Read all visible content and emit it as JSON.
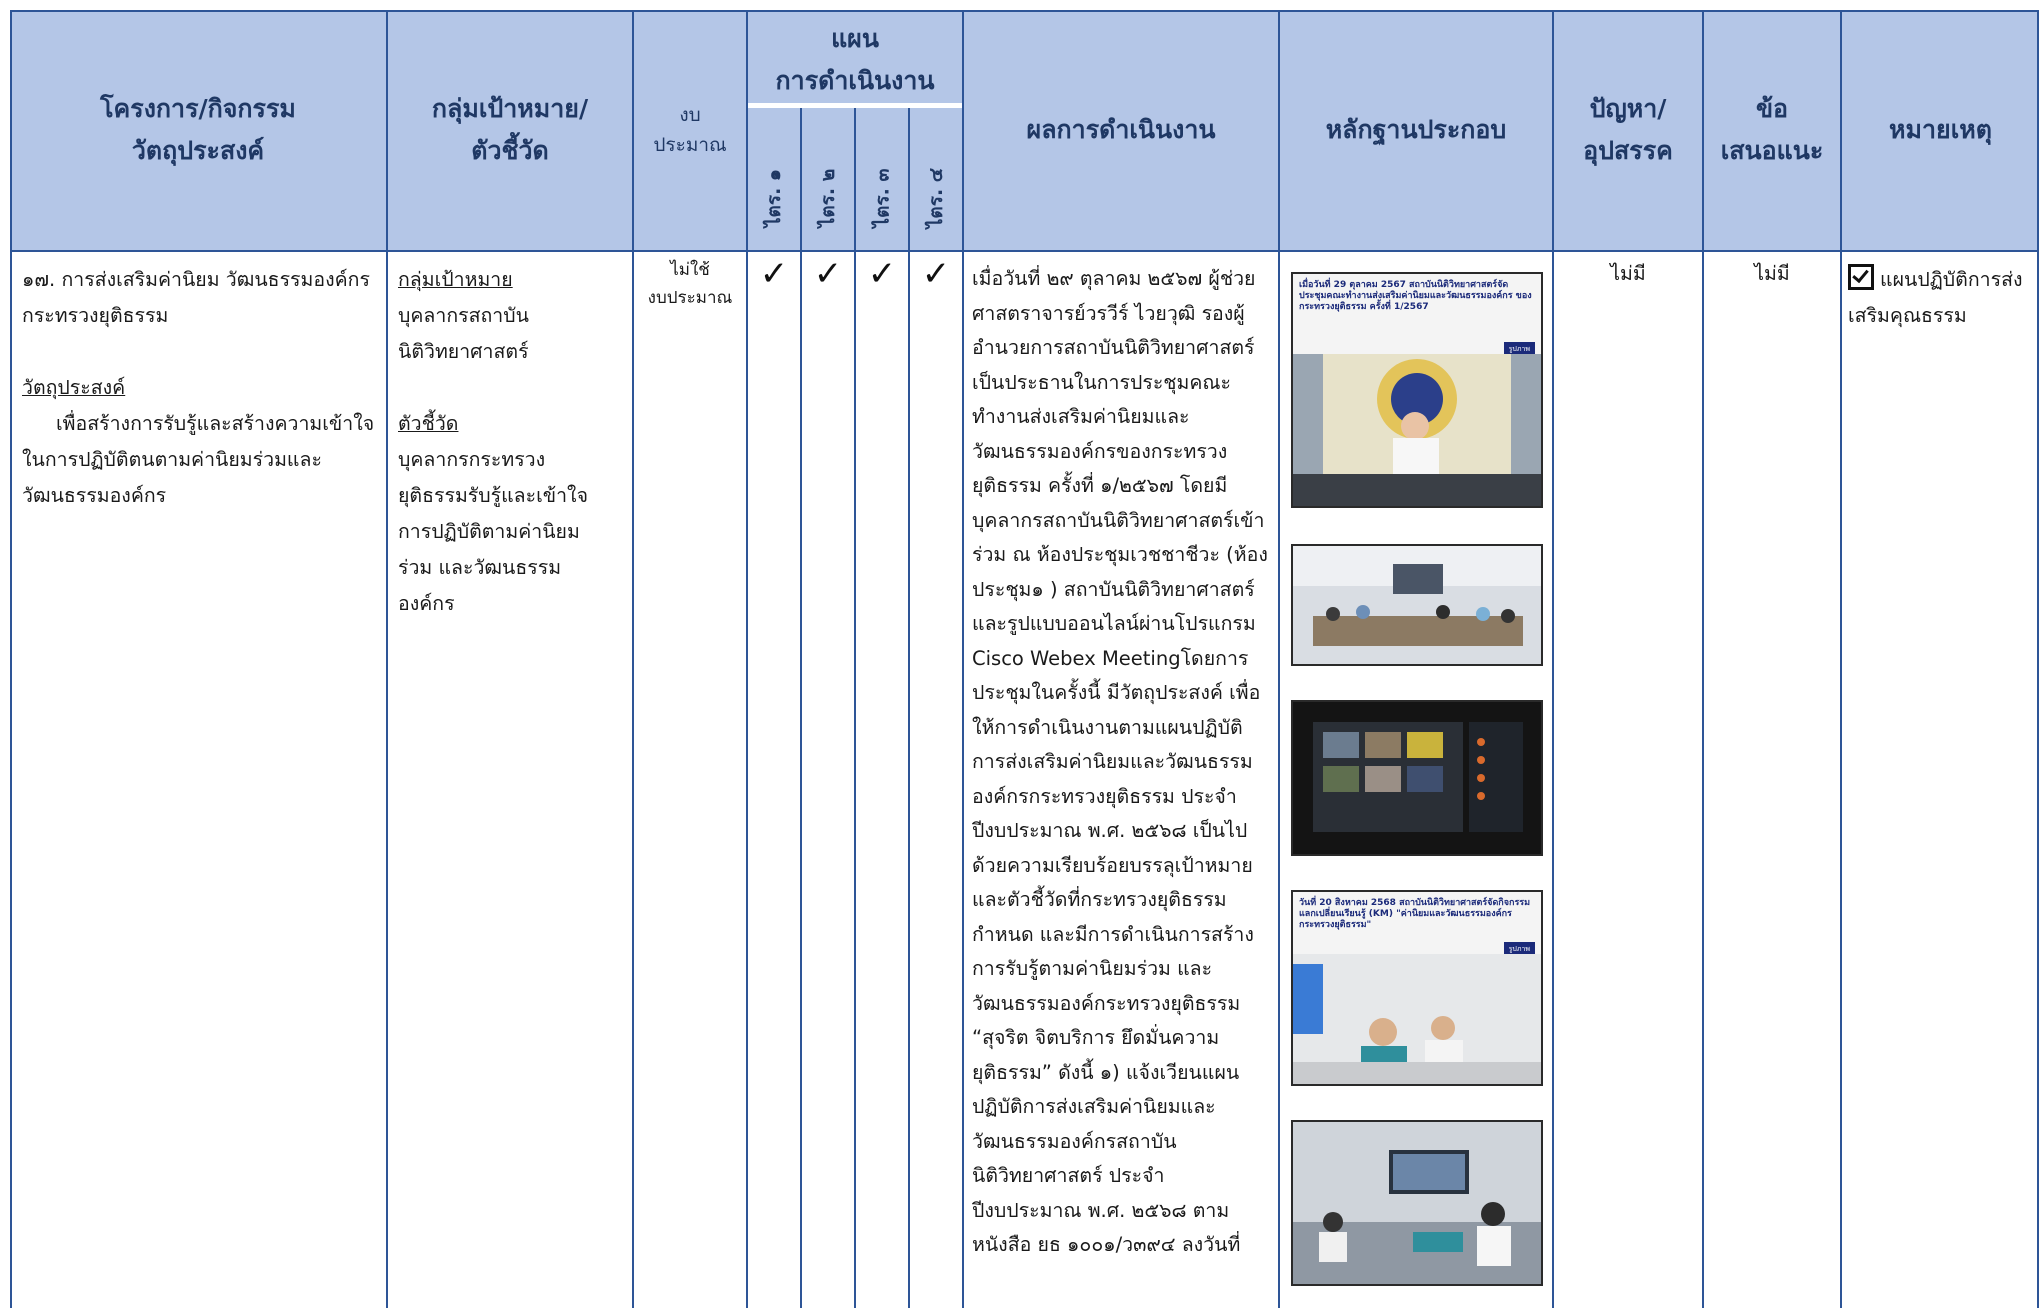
{
  "headers": {
    "project": "โครงการ/กิจกรรม\nวัตถุประสงค์",
    "target": "กลุ่มเป้าหมาย/\nตัวชี้วัด",
    "budget": "งบ\nประมาณ",
    "plan": "แผน\nการดำเนินงาน",
    "quarters": [
      "ไตร. ๑",
      "ไตร. ๒",
      "ไตร. ๓",
      "ไตร. ๔"
    ],
    "results": "ผลการดำเนินงาน",
    "evidence": "หลักฐานประกอบ",
    "problems": "ปัญหา/\nอุปสรรค",
    "suggestions": "ข้อ\nเสนอแนะ",
    "remarks": "หมายเหตุ"
  },
  "row": {
    "project_title": "๑๗. การส่งเสริมค่านิยม วัฒนธรรมองค์กร กระทรวงยุติธรรม",
    "objective_label": "วัตถุประสงค์",
    "objective_text": "เพื่อสร้างการรับรู้และสร้างความเข้าใจในการปฏิบัติตนตามค่านิยมร่วมและวัฒนธรรมองค์กร",
    "target_label": "กลุ่มเป้าหมาย",
    "target_text": "บุคลากรสถาบันนิติวิทยาศาสตร์",
    "indicator_label": "ตัวชี้วัด",
    "indicator_text": "บุคลากรกระทรวงยุติธรรมรับรู้และเข้าใจการปฏิบัติตามค่านิยมร่วม และวัฒนธรรมองค์กร",
    "budget": "ไม่ใช้\nงบประมาณ",
    "quarter_checks": [
      "✓",
      "✓",
      "✓",
      "✓"
    ],
    "results": "เมื่อวันที่ ๒๙ ตุลาคม ๒๕๖๗ ผู้ช่วยศาสตราจารย์วรวีร์ ไวยวุฒิ รองผู้อำนวยการสถาบันนิติวิทยาศาสตร์เป็นประธานในการประชุมคณะทำงานส่งเสริมค่านิยมและวัฒนธรรมองค์กรของกระทรวงยุติธรรม ครั้งที่ ๑/๒๕๖๗ โดยมีบุคลากรสถาบันนิติวิทยาศาสตร์เข้าร่วม ณ ห้องประชุมเวชชาชีวะ (ห้องประชุม๑ ) สถาบันนิติวิทยาศาสตร์และรูปแบบออนไลน์ผ่านโปรแกรม Cisco Webex Meetingโดยการประชุมในครั้งนี้ มีวัตถุประสงค์ เพื่อให้การดำเนินงานตามแผนปฏิบัติการส่งเสริมค่านิยมและวัฒนธรรมองค์กรกระทรวงยุติธรรม ประจำปีงบประมาณ พ.ศ. ๒๕๖๘ เป็นไปด้วยความเรียบร้อยบรรลุเป้าหมายและตัวชี้วัดที่กระทรวงยุติธรรมกำหนด และมีการดำเนินการสร้างการรับรู้ตามค่านิยมร่วม และ วัฒนธรรมองค์กระทรวงยุติธรรม “สุจริต จิตบริการ ยึดมั่นความยุติธรรม” ดังนี้ ๑) แจ้งเวียนแผนปฏิบัติการส่งเสริมค่านิยมและวัฒนธรรมองค์กรสถาบันนิติวิทยาศาสตร์ ประจำปีงบประมาณ พ.ศ. ๒๕๖๘ ตามหนังสือ ยธ ๑๐๐๑/ว๓๙๔ ลงวันที่",
    "evidence": [
      {
        "caption": "เมื่อวันที่ 29 ตุลาคม 2567 สถาบันนิติวิทยาศาสตร์จัดประชุมคณะทำงานส่งเสริมค่านิยมและวัฒนธรรมองค์กร ของกระทรวงยุติธรรม ครั้งที่ 1/2567",
        "button": "รูปภาพ"
      },
      {
        "caption": "",
        "button": ""
      },
      {
        "caption": "",
        "button": ""
      },
      {
        "caption": "วันที่ 20 สิงหาคม 2568 สถาบันนิติวิทยาศาสตร์จัดกิจกรรมแลกเปลี่ยนเรียนรู้ (KM) \"ค่านิยมและวัฒนธรรมองค์กรกระทรวงยุติธรรม\"",
        "button": "รูปภาพ"
      },
      {
        "caption": "",
        "button": ""
      }
    ],
    "problems": "ไม่มี",
    "suggestions": "ไม่มี",
    "remarks": "แผนปฏิบัติการส่งเสริมคุณธรรม"
  }
}
